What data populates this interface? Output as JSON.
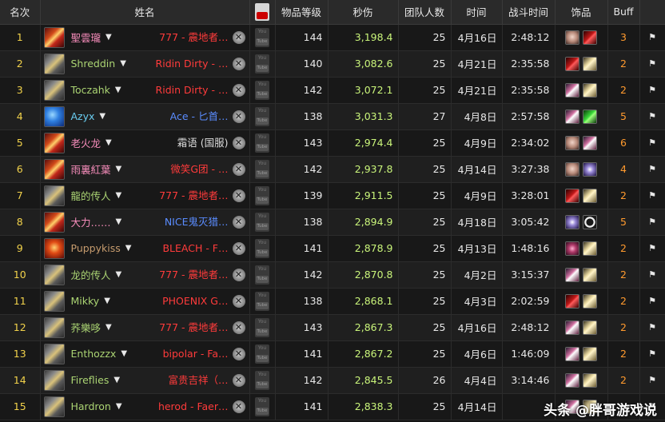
{
  "headers": {
    "rank": "名次",
    "name": "姓名",
    "ilvl": "物品等级",
    "dps": "秒伤",
    "raid_size": "团队人数",
    "date": "时间",
    "duration": "战斗时间",
    "trinkets": "饰品",
    "buff": "Buff"
  },
  "rows": [
    {
      "rank": "1",
      "avatar": "fire",
      "name": "聖雲瓏",
      "name_class": "pal",
      "guild": "777 - 震地者…",
      "guild_color": "red",
      "ilvl": "144",
      "dps": "3,198.4",
      "size": "25",
      "date": "4月16日",
      "duration": "2:48:12",
      "trinkets": [
        "skull",
        "red"
      ],
      "buff": "3"
    },
    {
      "rank": "2",
      "avatar": "gold",
      "name": "Shreddin",
      "name_class": "hun",
      "guild": "Ridin Dirty - …",
      "guild_color": "red",
      "ilvl": "140",
      "dps": "3,082.6",
      "size": "25",
      "date": "4月21日",
      "duration": "2:35:58",
      "trinkets": [
        "red",
        "lightning"
      ],
      "buff": "2"
    },
    {
      "rank": "3",
      "avatar": "gold",
      "name": "Toczahk",
      "name_class": "hun",
      "guild": "Ridin Dirty - …",
      "guild_color": "red",
      "ilvl": "142",
      "dps": "3,072.1",
      "size": "25",
      "date": "4月21日",
      "duration": "2:35:58",
      "trinkets": [
        "crystal",
        "lightning"
      ],
      "buff": "2"
    },
    {
      "rank": "4",
      "avatar": "blue",
      "name": "Azyx",
      "name_class": "mag",
      "guild": "Ace - 匕首…",
      "guild_color": "blue",
      "ilvl": "138",
      "dps": "3,031.3",
      "size": "27",
      "date": "4月8日",
      "duration": "2:57:58",
      "trinkets": [
        "crystal",
        "green"
      ],
      "buff": "5"
    },
    {
      "rank": "5",
      "avatar": "fire",
      "name": "老火龙",
      "name_class": "pal",
      "guild": "霜语 (国服)",
      "guild_color": "white",
      "ilvl": "143",
      "dps": "2,974.4",
      "size": "25",
      "date": "4月9日",
      "duration": "2:34:02",
      "trinkets": [
        "skull",
        "crystal"
      ],
      "buff": "6"
    },
    {
      "rank": "6",
      "avatar": "fire",
      "name": "雨裏紅葉",
      "name_class": "pal",
      "guild": "微笑G团 - …",
      "guild_color": "red",
      "ilvl": "142",
      "dps": "2,937.8",
      "size": "25",
      "date": "4月14日",
      "duration": "3:27:38",
      "trinkets": [
        "skull",
        "orb"
      ],
      "buff": "4"
    },
    {
      "rank": "7",
      "avatar": "gold",
      "name": "龍的传人",
      "name_class": "hun",
      "guild": "777 - 震地者…",
      "guild_color": "red",
      "ilvl": "139",
      "dps": "2,911.5",
      "size": "25",
      "date": "4月9日",
      "duration": "3:28:01",
      "trinkets": [
        "red",
        "lightning"
      ],
      "buff": "2"
    },
    {
      "rank": "8",
      "avatar": "fire",
      "name": "大力……",
      "name_class": "pal",
      "guild": "NICE鬼灭猎…",
      "guild_color": "blue",
      "ilvl": "138",
      "dps": "2,894.9",
      "size": "25",
      "date": "4月18日",
      "duration": "3:05:42",
      "trinkets": [
        "orb",
        "moon"
      ],
      "buff": "5"
    },
    {
      "rank": "9",
      "avatar": "red",
      "name": "Puppykiss",
      "name_class": "war",
      "guild": "BLEACH - F…",
      "guild_color": "red",
      "ilvl": "141",
      "dps": "2,878.9",
      "size": "25",
      "date": "4月13日",
      "duration": "1:48:16",
      "trinkets": [
        "eye",
        "lightning"
      ],
      "buff": "2"
    },
    {
      "rank": "10",
      "avatar": "gold",
      "name": "龙的传人",
      "name_class": "hun",
      "guild": "777 - 震地者…",
      "guild_color": "red",
      "ilvl": "142",
      "dps": "2,870.8",
      "size": "25",
      "date": "4月2日",
      "duration": "3:15:37",
      "trinkets": [
        "crystal",
        "lightning"
      ],
      "buff": "2"
    },
    {
      "rank": "11",
      "avatar": "gold",
      "name": "Mikky",
      "name_class": "hun",
      "guild": "PHOENIX G…",
      "guild_color": "red",
      "ilvl": "138",
      "dps": "2,868.1",
      "size": "25",
      "date": "4月3日",
      "duration": "2:02:59",
      "trinkets": [
        "red",
        "lightning"
      ],
      "buff": "2"
    },
    {
      "rank": "12",
      "avatar": "gold",
      "name": "荞樂哆",
      "name_class": "hun",
      "guild": "777 - 震地者…",
      "guild_color": "red",
      "ilvl": "143",
      "dps": "2,867.3",
      "size": "25",
      "date": "4月16日",
      "duration": "2:48:12",
      "trinkets": [
        "crystal",
        "lightning"
      ],
      "buff": "2"
    },
    {
      "rank": "13",
      "avatar": "gold",
      "name": "Enthozzx",
      "name_class": "hun",
      "guild": "bipolar - Fa…",
      "guild_color": "red",
      "ilvl": "141",
      "dps": "2,867.2",
      "size": "25",
      "date": "4月6日",
      "duration": "1:46:09",
      "trinkets": [
        "crystal",
        "lightning"
      ],
      "buff": "2"
    },
    {
      "rank": "14",
      "avatar": "gold",
      "name": "Fireflies",
      "name_class": "hun",
      "guild": "富贵吉祥（…",
      "guild_color": "red",
      "ilvl": "142",
      "dps": "2,845.5",
      "size": "26",
      "date": "4月4日",
      "duration": "3:14:46",
      "trinkets": [
        "crystal",
        "lightning"
      ],
      "buff": "2"
    },
    {
      "rank": "15",
      "avatar": "gold",
      "name": "Hardron",
      "name_class": "hun",
      "guild": "herod - Faer…",
      "guild_color": "red",
      "ilvl": "141",
      "dps": "2,838.3",
      "size": "25",
      "date": "4月14日",
      "duration": "",
      "trinkets": [
        "crystal",
        "lightning"
      ],
      "buff": ""
    }
  ],
  "watermark": "头条 @胖哥游戏说"
}
